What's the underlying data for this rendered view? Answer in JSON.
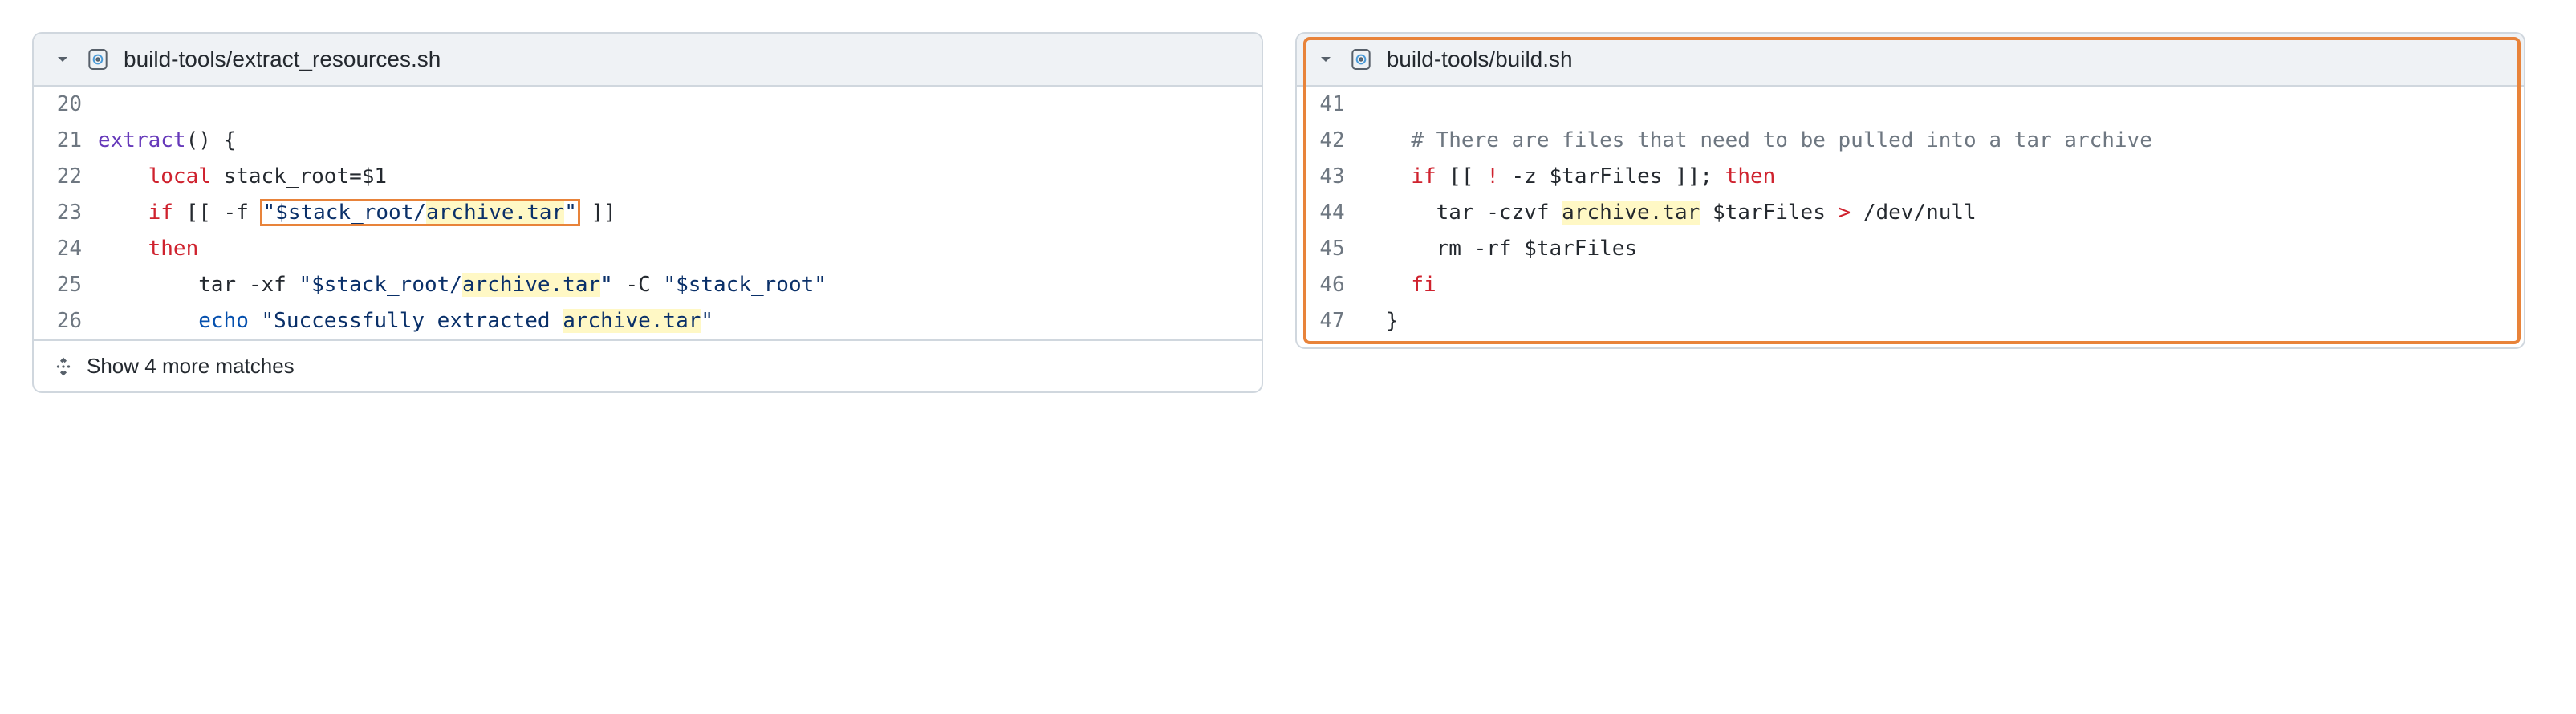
{
  "left": {
    "file_path": "build-tools/extract_resources.sh",
    "lines": [
      {
        "n": "20",
        "tokens": []
      },
      {
        "n": "21",
        "tokens": [
          {
            "cls": "tok-func",
            "text": "extract"
          },
          {
            "cls": "tok-plain",
            "text": "() {"
          }
        ]
      },
      {
        "n": "22",
        "tokens": [
          {
            "cls": "tok-plain",
            "text": "    "
          },
          {
            "cls": "tok-keyword",
            "text": "local"
          },
          {
            "cls": "tok-plain",
            "text": " stack_root=$1"
          }
        ]
      },
      {
        "n": "23",
        "tokens": [
          {
            "cls": "tok-plain",
            "text": "    "
          },
          {
            "cls": "tok-keyword",
            "text": "if"
          },
          {
            "cls": "tok-plain",
            "text": " [[ -f "
          },
          {
            "cls": "tok-string orange-box",
            "text": "\"$stack_root/",
            "inner": [
              {
                "cls": "highlight",
                "text": "archive.tar"
              },
              {
                "cls": "",
                "text": "\""
              }
            ],
            "boxed": true
          },
          {
            "cls": "tok-plain",
            "text": " ]]"
          }
        ]
      },
      {
        "n": "24",
        "tokens": [
          {
            "cls": "tok-plain",
            "text": "    "
          },
          {
            "cls": "tok-keyword",
            "text": "then"
          }
        ]
      },
      {
        "n": "25",
        "tokens": [
          {
            "cls": "tok-plain",
            "text": "        tar -xf "
          },
          {
            "cls": "tok-string",
            "text": "\"$stack_root/"
          },
          {
            "cls": "tok-string highlight",
            "text": "archive.tar"
          },
          {
            "cls": "tok-string",
            "text": "\""
          },
          {
            "cls": "tok-plain",
            "text": " -C "
          },
          {
            "cls": "tok-string",
            "text": "\"$stack_root\""
          }
        ]
      },
      {
        "n": "26",
        "tokens": [
          {
            "cls": "tok-plain",
            "text": "        "
          },
          {
            "cls": "tok-builtin",
            "text": "echo"
          },
          {
            "cls": "tok-plain",
            "text": " "
          },
          {
            "cls": "tok-string",
            "text": "\"Successfully extracted "
          },
          {
            "cls": "tok-string highlight",
            "text": "archive.tar"
          },
          {
            "cls": "tok-string",
            "text": "\""
          }
        ]
      }
    ],
    "footer_text": "Show 4 more matches"
  },
  "right": {
    "file_path": "build-tools/build.sh",
    "lines": [
      {
        "n": "41",
        "tokens": []
      },
      {
        "n": "42",
        "tokens": [
          {
            "cls": "tok-plain",
            "text": "    "
          },
          {
            "cls": "tok-comment",
            "text": "# There are files that need to be pulled into a tar archive"
          }
        ]
      },
      {
        "n": "43",
        "tokens": [
          {
            "cls": "tok-plain",
            "text": "    "
          },
          {
            "cls": "tok-keyword",
            "text": "if"
          },
          {
            "cls": "tok-plain",
            "text": " [[ "
          },
          {
            "cls": "tok-keyword",
            "text": "!"
          },
          {
            "cls": "tok-plain",
            "text": " -z $tarFiles ]]; "
          },
          {
            "cls": "tok-keyword",
            "text": "then"
          }
        ]
      },
      {
        "n": "44",
        "tokens": [
          {
            "cls": "tok-plain",
            "text": "      tar -czvf "
          },
          {
            "cls": "tok-plain highlight",
            "text": "archive.tar"
          },
          {
            "cls": "tok-plain",
            "text": " $tarFiles "
          },
          {
            "cls": "tok-keyword",
            "text": ">"
          },
          {
            "cls": "tok-plain",
            "text": " /dev/null"
          }
        ]
      },
      {
        "n": "45",
        "tokens": [
          {
            "cls": "tok-plain",
            "text": "      rm -rf $tarFiles"
          }
        ]
      },
      {
        "n": "46",
        "tokens": [
          {
            "cls": "tok-plain",
            "text": "    "
          },
          {
            "cls": "tok-keyword",
            "text": "fi"
          }
        ]
      },
      {
        "n": "47",
        "tokens": [
          {
            "cls": "tok-plain",
            "text": "  }"
          }
        ]
      }
    ]
  }
}
